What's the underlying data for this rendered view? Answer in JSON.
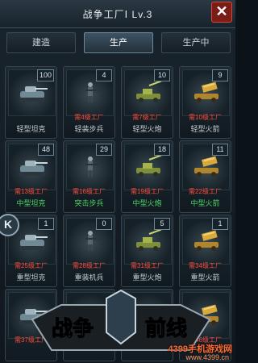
{
  "window": {
    "title": "战争工厂Ⅰ Lv.3",
    "close_label": "✕"
  },
  "tabs": [
    {
      "label": "建造",
      "active": false
    },
    {
      "label": "生产",
      "active": true
    },
    {
      "label": "生产中",
      "active": false
    }
  ],
  "units": [
    {
      "count": "100",
      "requirement": "",
      "name": "轻型坦克",
      "icon": "tank-icon"
    },
    {
      "count": "4",
      "requirement": "需4级工厂",
      "name": "轻装步兵",
      "icon": "infantry-icon"
    },
    {
      "count": "10",
      "requirement": "需7级工厂",
      "name": "轻型火炮",
      "icon": "artillery-icon"
    },
    {
      "count": "9",
      "requirement": "需10级工厂",
      "name": "轻型火箭",
      "icon": "rocket-launcher-icon"
    },
    {
      "count": "48",
      "requirement": "需13级工厂",
      "name": "中型坦克",
      "icon": "tank-icon"
    },
    {
      "count": "29",
      "requirement": "需16级工厂",
      "name": "突击步兵",
      "icon": "infantry-icon"
    },
    {
      "count": "18",
      "requirement": "需19级工厂",
      "name": "中型火炮",
      "icon": "artillery-icon"
    },
    {
      "count": "11",
      "requirement": "需22级工厂",
      "name": "中型火箭",
      "icon": "rocket-launcher-icon"
    },
    {
      "count": "1",
      "requirement": "需25级工厂",
      "name": "重型坦克",
      "icon": "tank-icon"
    },
    {
      "count": "0",
      "requirement": "需28级工厂",
      "name": "重装机兵",
      "icon": "infantry-icon"
    },
    {
      "count": "5",
      "requirement": "需31级工厂",
      "name": "重型火炮",
      "icon": "artillery-icon"
    },
    {
      "count": "1",
      "requirement": "需34级工厂",
      "name": "重型火箭",
      "icon": "rocket-launcher-icon"
    },
    {
      "count": "",
      "requirement": "需37级工厂",
      "name": "",
      "icon": "tank-icon"
    },
    {
      "count": "",
      "requirement": "需40级工厂",
      "name": "",
      "icon": "infantry-icon"
    },
    {
      "count": "",
      "requirement": "需43级工厂",
      "name": "",
      "icon": "artillery-icon"
    },
    {
      "count": "",
      "requirement": "需46级工厂",
      "name": "",
      "icon": "rocket-launcher-icon"
    }
  ],
  "side_button": {
    "label": "K"
  },
  "logo": {
    "text_left": "战争",
    "text_right": "前线"
  },
  "watermark": {
    "line1": "4399手机游戏网",
    "line2": "www.4399.cn"
  },
  "colors": {
    "requirement_red": "#ff4b3e",
    "name_green": "#4fd36a",
    "close_red": "#7a1c18"
  }
}
